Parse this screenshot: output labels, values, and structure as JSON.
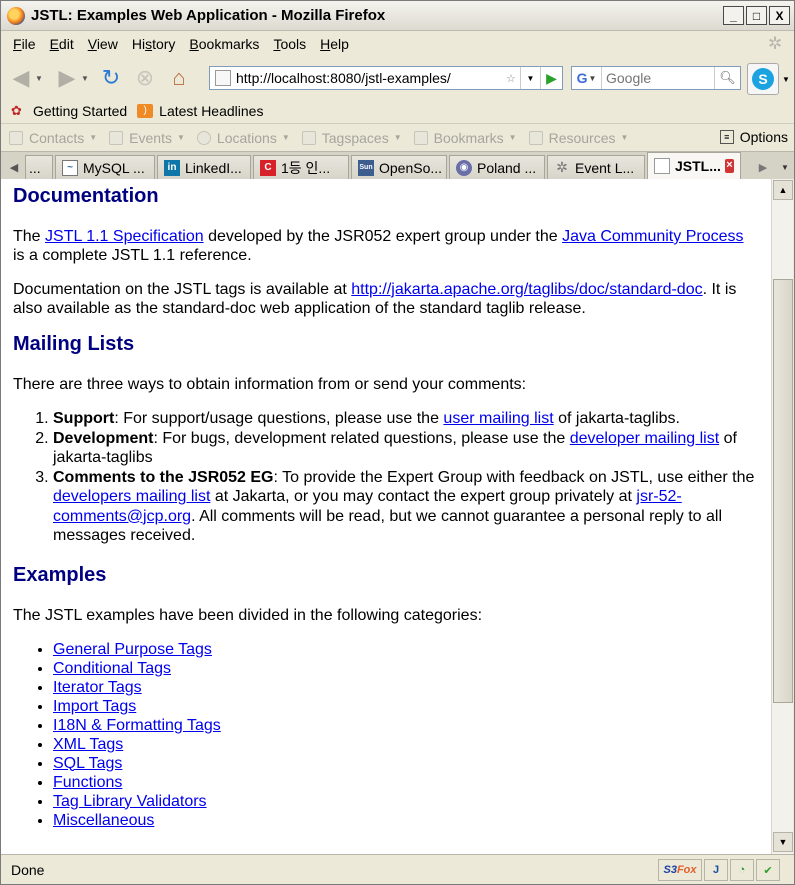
{
  "window": {
    "title": "JSTL: Examples Web Application - Mozilla Firefox",
    "minimize": "_",
    "maximize": "□",
    "close": "X"
  },
  "menu": [
    "File",
    "Edit",
    "View",
    "History",
    "Bookmarks",
    "Tools",
    "Help"
  ],
  "menu_mnemonic": [
    "F",
    "E",
    "V",
    "s",
    "B",
    "T",
    "H"
  ],
  "nav": {
    "url": "http://localhost:8080/jstl-examples/",
    "search_engine": "G",
    "search_placeholder": "Google"
  },
  "bookmarks_bar": {
    "items": [
      "Getting Started",
      "Latest Headlines"
    ]
  },
  "extension_bar": {
    "items": [
      "Contacts",
      "Events",
      "Locations",
      "Tagspaces",
      "Bookmarks",
      "Resources"
    ],
    "options": "Options"
  },
  "tabs": [
    {
      "label": "...",
      "icon": "blank-page",
      "active": false
    },
    {
      "label": "MySQL ...",
      "icon": "mysql",
      "active": false
    },
    {
      "label": "LinkedI...",
      "icon": "linkedin",
      "active": false
    },
    {
      "label": "1등 인...",
      "icon": "c-logo",
      "active": false
    },
    {
      "label": "OpenSo...",
      "icon": "sun",
      "active": false
    },
    {
      "label": "Poland ...",
      "icon": "globe",
      "active": false
    },
    {
      "label": "Event L...",
      "icon": "spinner",
      "active": false
    },
    {
      "label": "JSTL...",
      "icon": "page",
      "active": true
    }
  ],
  "page": {
    "documentation": {
      "heading": "Documentation",
      "p1_pre": "The ",
      "p1_link1": "JSTL 1.1 Specification",
      "p1_mid": " developed by the JSR052 expert group under the ",
      "p1_link2": "Java Community Process",
      "p1_post": " is a complete JSTL 1.1 reference.",
      "p2_pre": "Documentation on the JSTL tags is available at ",
      "p2_link": "http://jakarta.apache.org/taglibs/doc/standard-doc",
      "p2_post": ". It is also available as the standard-doc web application of the standard taglib release."
    },
    "mailing": {
      "heading": "Mailing Lists",
      "intro": "There are three ways to obtain information from or send your comments:",
      "item1_strong": "Support",
      "item1_pre": ": For support/usage questions, please use the ",
      "item1_link": "user mailing list",
      "item1_post": " of jakarta-taglibs.",
      "item2_strong": "Development",
      "item2_pre": ": For bugs, development related questions, please use the ",
      "item2_link": "developer mailing list",
      "item2_post": " of jakarta-taglibs",
      "item3_strong": "Comments to the JSR052 EG",
      "item3_pre": ": To provide the Expert Group with feedback on JSTL, use either the ",
      "item3_link1": "developers mailing list",
      "item3_mid": " at Jakarta, or you may contact the expert group privately at ",
      "item3_link2": "jsr-52-comments@jcp.org",
      "item3_post": ". All comments will be read, but we cannot guarantee a personal reply to all messages received."
    },
    "examples": {
      "heading": "Examples",
      "intro": "The JSTL examples have been divided in the following categories:",
      "links": [
        "General Purpose Tags",
        "Conditional Tags",
        "Iterator Tags",
        "Import Tags",
        "I18N & Formatting Tags",
        "XML Tags",
        "SQL Tags",
        "Functions",
        "Tag Library Validators",
        "Miscellaneous"
      ]
    }
  },
  "status": {
    "text": "Done",
    "s3fox_a": "S3",
    "s3fox_b": "Fox"
  }
}
